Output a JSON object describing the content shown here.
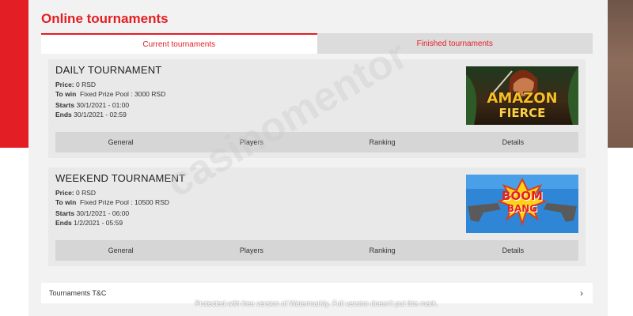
{
  "page": {
    "title": "Online tournaments"
  },
  "tabs": [
    {
      "label": "Current tournaments",
      "active": true
    },
    {
      "label": "Finished tournaments",
      "active": false
    }
  ],
  "tournaments": [
    {
      "name": "DAILY TOURNAMENT",
      "price_label": "Price:",
      "price_value": "0 RSD",
      "win_label": "To win",
      "win_value": "Fixed Prize Pool : 3000 RSD",
      "starts_label": "Starts",
      "starts_value": "30/1/2021 - 01:00",
      "ends_label": "Ends",
      "ends_value": "30/1/2021 - 02:59",
      "game_logo_line1": "AMAZON",
      "game_logo_line2": "FIERCE",
      "nav": [
        "General",
        "Players",
        "Ranking",
        "Details"
      ]
    },
    {
      "name": "WEEKEND TOURNAMENT",
      "price_label": "Price:",
      "price_value": "0 RSD",
      "win_label": "To win",
      "win_value": "Fixed Prize Pool : 10500 RSD",
      "starts_label": "Starts",
      "starts_value": "30/1/2021 - 06:00",
      "ends_label": "Ends",
      "ends_value": "1/2/2021 - 05:59",
      "game_logo_line1": "BOOM",
      "game_logo_line2": "BANG",
      "nav": [
        "General",
        "Players",
        "Ranking",
        "Details"
      ]
    }
  ],
  "terms": {
    "label": "Tournaments T&C",
    "chevron_icon": "chevron-right-icon"
  },
  "overlay": {
    "watermark": "casinomentor",
    "notice": "Protected with free version of Watermarkly. Full version doesn't put this mark."
  },
  "colors": {
    "accent": "#e31e24",
    "card_bg": "#e9e9e9",
    "subnav_bg": "#d6d6d6"
  }
}
